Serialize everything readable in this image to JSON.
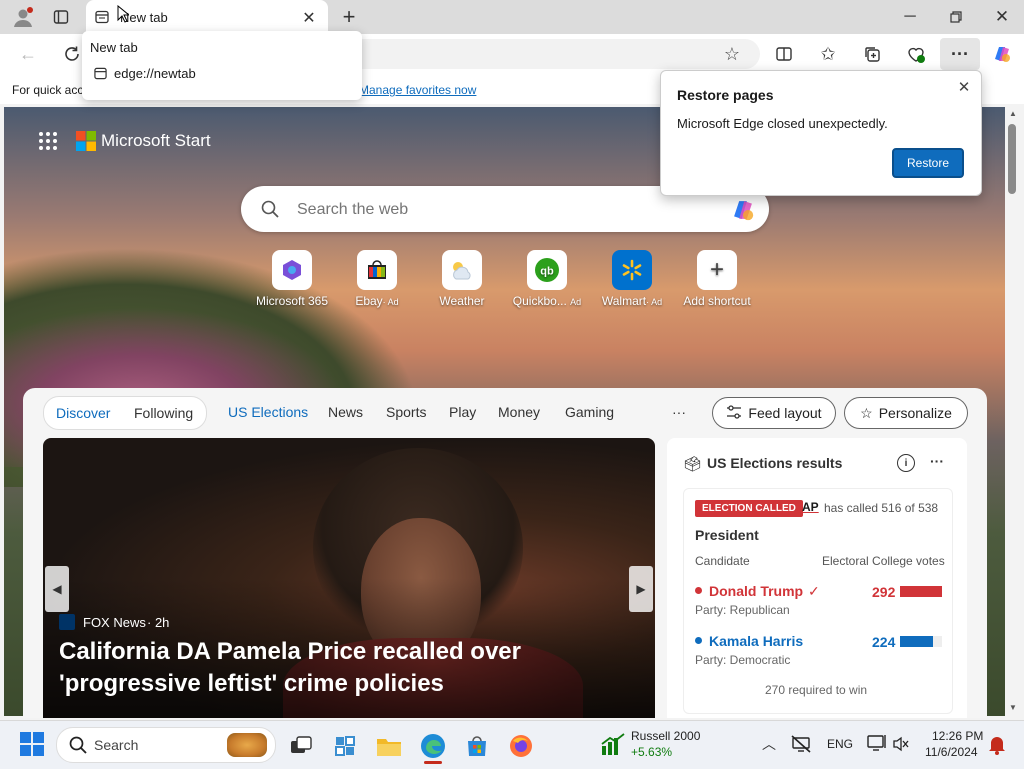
{
  "browser": {
    "tab_title": "New tab",
    "tab_tooltip_title": "New tab",
    "tab_tooltip_url": "edge://newtab",
    "favorites_bar_text": "For quick access, place your favorites here on the favorites bar.",
    "favorites_bar_link": "Manage favorites now"
  },
  "restore_popup": {
    "title": "Restore pages",
    "message": "Microsoft Edge closed unexpectedly.",
    "button": "Restore"
  },
  "start": {
    "brand": "Microsoft Start",
    "search_placeholder": "Search the web",
    "shortcuts": [
      {
        "label": "Microsoft 365",
        "ad": ""
      },
      {
        "label": "Ebay",
        "ad": "· Ad"
      },
      {
        "label": "Weather",
        "ad": ""
      },
      {
        "label": "Quickbo...",
        "ad": "Ad"
      },
      {
        "label": "Walmart",
        "ad": "· Ad"
      },
      {
        "label": "Add shortcut",
        "ad": ""
      }
    ]
  },
  "feed": {
    "tabs": [
      "Discover",
      "Following"
    ],
    "nav": [
      "US Elections",
      "News",
      "Sports",
      "Play",
      "Money",
      "Gaming"
    ],
    "more": "···",
    "feed_layout": "Feed layout",
    "personalize": "Personalize",
    "hero": {
      "source": "FOX News",
      "age": "· 2h",
      "headline": "California DA Pamela Price recalled over 'progressive leftist' crime policies"
    }
  },
  "election": {
    "title": "US Elections results",
    "badge": "ELECTION CALLED",
    "ap": "AP",
    "called_text": "has called 516 of 538",
    "race": "President",
    "col_candidate": "Candidate",
    "col_votes": "Electoral College votes",
    "candidates": [
      {
        "name": "Donald Trump",
        "check": "✓",
        "party": "Party: Republican",
        "votes": "292",
        "color": "#d13438",
        "share": 0.54
      },
      {
        "name": "Kamala Harris",
        "check": "",
        "party": "Party: Democratic",
        "votes": "224",
        "color": "#0f6cbd",
        "share": 0.42
      }
    ],
    "required": "270 required to win"
  },
  "taskbar": {
    "search": "Search",
    "stock_name": "Russell 2000",
    "stock_change": "+5.63%",
    "lang": "ENG",
    "time": "12:26 PM",
    "date": "11/6/2024"
  },
  "colors": {
    "accent": "#0f6cbd",
    "restore_button": "#0f6cbd",
    "badge": "#d13438"
  }
}
